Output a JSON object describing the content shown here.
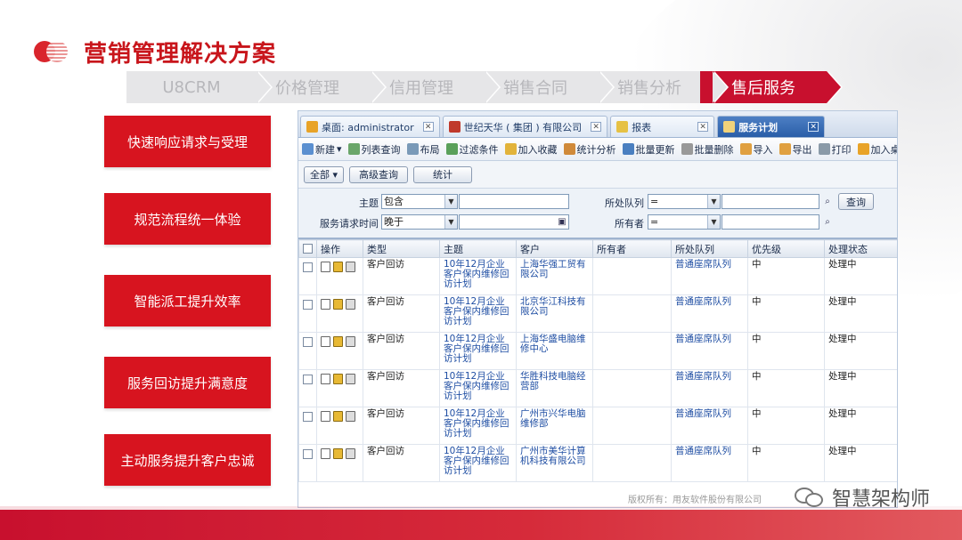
{
  "title": "营销管理解决方案",
  "crumbs": [
    "U8CRM",
    "价格管理",
    "信用管理",
    "销售合同",
    "销售分析",
    "售后服务"
  ],
  "features": [
    "快速响应请求与受理",
    "规范流程统一体验",
    "智能派工提升效率",
    "服务回访提升满意度",
    "主动服务提升客户忠诚"
  ],
  "app": {
    "tabs": [
      {
        "label": "桌面: administrator"
      },
      {
        "label": "世纪天华 ( 集团 ) 有限公司"
      },
      {
        "label": "报表"
      },
      {
        "label": "服务计划"
      }
    ],
    "toolbar": [
      "新建",
      "列表查询",
      "布局",
      "过滤条件",
      "加入收藏",
      "统计分析",
      "批量更新",
      "批量删除",
      "导入",
      "导出",
      "打印",
      "加入桌面"
    ],
    "actions": {
      "all": "全部",
      "advanced": "高级查询",
      "stats": "统计"
    },
    "filter": {
      "subject_label": "主题",
      "subject_op": "包含",
      "time_label": "服务请求时间",
      "time_op": "晚于",
      "queue_label": "所处队列",
      "queue_op": "=",
      "owner_label": "所有者",
      "owner_op": "=",
      "query_button": "查询"
    },
    "columns": [
      "操作",
      "类型",
      "主题",
      "客户",
      "所有者",
      "所处队列",
      "优先级",
      "处理状态"
    ],
    "rows": [
      {
        "type": "客户回访",
        "subject": "10年12月企业客户保内维修回访计划",
        "customer": "上海华强工贸有限公司",
        "owner": "",
        "queue": "普通座席队列",
        "priority": "中",
        "status": "处理中"
      },
      {
        "type": "客户回访",
        "subject": "10年12月企业客户保内维修回访计划",
        "customer": "北京华江科技有限公司",
        "owner": "",
        "queue": "普通座席队列",
        "priority": "中",
        "status": "处理中"
      },
      {
        "type": "客户回访",
        "subject": "10年12月企业客户保内维修回访计划",
        "customer": "上海华盛电脑维修中心",
        "owner": "",
        "queue": "普通座席队列",
        "priority": "中",
        "status": "处理中"
      },
      {
        "type": "客户回访",
        "subject": "10年12月企业客户保内维修回访计划",
        "customer": "华胜科技电脑经营部",
        "owner": "",
        "queue": "普通座席队列",
        "priority": "中",
        "status": "处理中"
      },
      {
        "type": "客户回访",
        "subject": "10年12月企业客户保内维修回访计划",
        "customer": "广州市兴华电脑维修部",
        "owner": "",
        "queue": "普通座席队列",
        "priority": "中",
        "status": "处理中"
      },
      {
        "type": "客户回访",
        "subject": "10年12月企业客户保内维修回访计划",
        "customer": "广州市美华计算机科技有限公司",
        "owner": "",
        "queue": "普通座席队列",
        "priority": "中",
        "status": "处理中"
      }
    ],
    "footer": "版权所有：用友软件股份有限公司"
  },
  "watermark": "智慧架构师",
  "colors": {
    "brand_red": "#c8102e",
    "crumb_grey": "#e6e6e8",
    "link_blue": "#1f4ea3"
  }
}
